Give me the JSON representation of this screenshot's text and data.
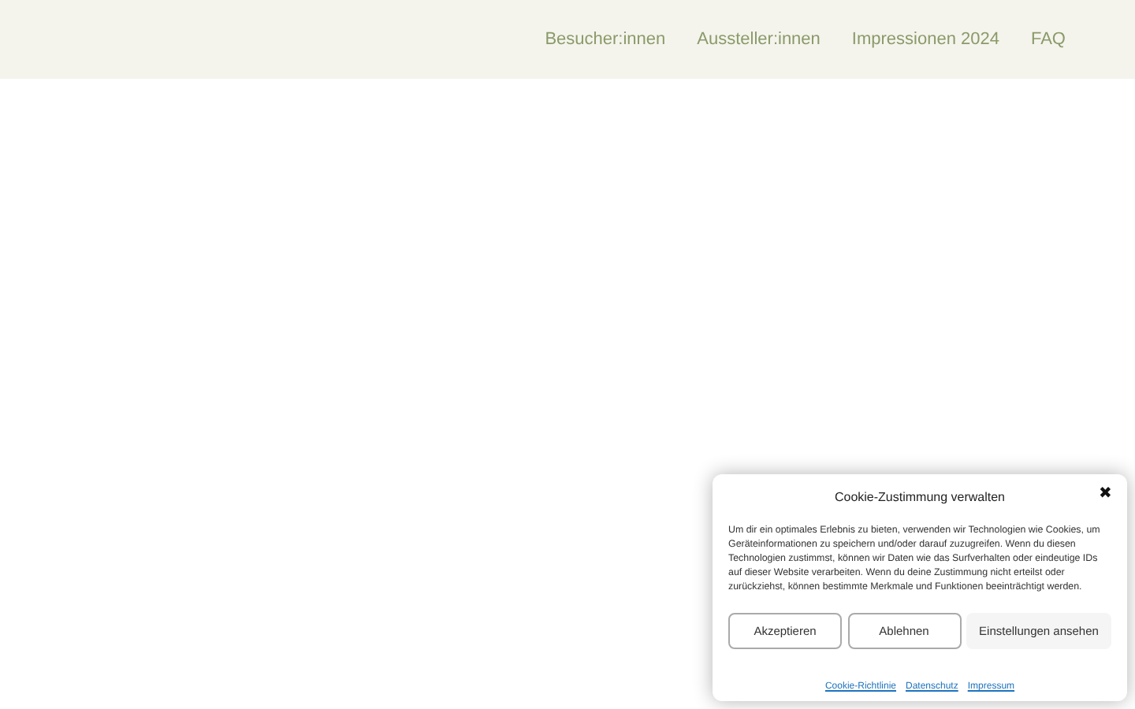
{
  "nav": {
    "items": [
      {
        "label": "Besucher:innen"
      },
      {
        "label": "Aussteller:innen"
      },
      {
        "label": "Impressionen 2024"
      },
      {
        "label": "FAQ"
      }
    ]
  },
  "cookie_dialog": {
    "title": "Cookie-Zustimmung verwalten",
    "close": "✖",
    "text": "Um dir ein optimales Erlebnis zu bieten, verwenden wir Technologien wie Cookies, um Geräteinformationen zu speichern und/oder darauf zuzugreifen. Wenn du diesen Technologien zustimmst, können wir Daten wie das Surfverhalten oder eindeutige IDs auf dieser Website verarbeiten. Wenn du deine Zustimmung nicht erteilst oder zurückziehst, können bestimmte Merkmale und Funktionen beeinträchtigt werden.",
    "buttons": [
      {
        "label": "Akzeptieren",
        "kind": "outline"
      },
      {
        "label": "Ablehnen",
        "kind": "outline"
      },
      {
        "label": "Einstellungen ansehen",
        "kind": "plain"
      }
    ],
    "links": [
      "Cookie-Richtlinie",
      "Datenschutz",
      "Impressum"
    ]
  }
}
